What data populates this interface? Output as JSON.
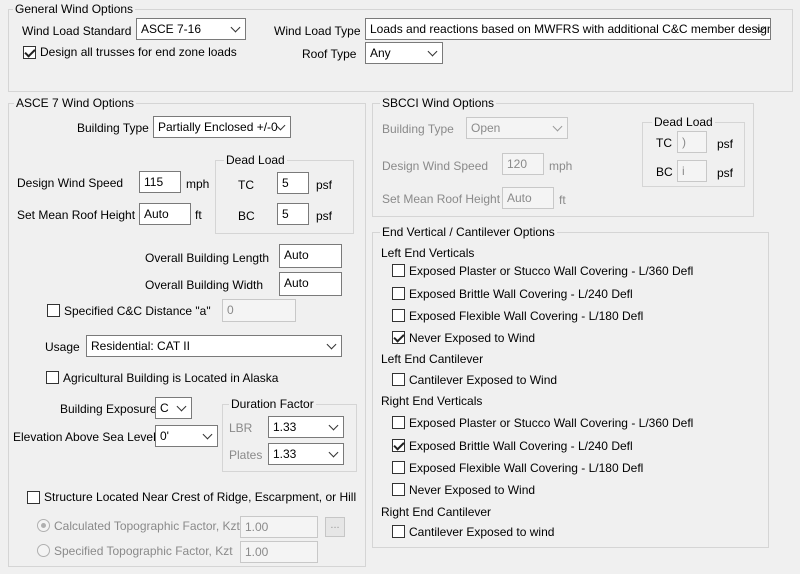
{
  "general": {
    "title": "General Wind Options",
    "wind_load_standard_label": "Wind Load Standard",
    "wind_load_standard_value": "ASCE 7-16",
    "wind_load_type_label": "Wind Load Type",
    "wind_load_type_value": "Loads and reactions based on MWFRS with additional C&C member design",
    "design_all_trusses_label": "Design all trusses for end zone loads",
    "roof_type_label": "Roof Type",
    "roof_type_value": "Any"
  },
  "asce": {
    "title": "ASCE 7 Wind Options",
    "building_type_label": "Building Type",
    "building_type_value": "Partially Enclosed +/-0",
    "design_wind_speed_label": "Design Wind Speed",
    "design_wind_speed_value": "115",
    "speed_unit": "mph",
    "mean_roof_height_label": "Set Mean Roof Height",
    "mean_roof_height_value": "Auto",
    "height_unit": "ft",
    "dead_load_title": "Dead Load",
    "tc_label": "TC",
    "tc_value": "5",
    "bc_label": "BC",
    "bc_value": "5",
    "psf": "psf",
    "overall_length_label": "Overall Building Length",
    "overall_length_value": "Auto",
    "overall_width_label": "Overall Building Width",
    "overall_width_value": "Auto",
    "specified_cc_label": "Specified C&C Distance \"a\"",
    "specified_cc_value": "0",
    "usage_label": "Usage",
    "usage_value": "Residential: CAT II",
    "agricultural_label": "Agricultural Building is Located in Alaska",
    "exposure_label": "Building Exposure",
    "exposure_value": "C",
    "elevation_label": "Elevation Above Sea Level",
    "elevation_value": "0'",
    "duration_title": "Duration Factor",
    "lbr_label": "LBR",
    "lbr_value": "1.33",
    "plates_label": "Plates",
    "plates_value": "1.33",
    "crest_label": "Structure Located Near Crest of Ridge, Escarpment, or Hill",
    "calc_topo_label": "Calculated Topographic Factor, Kzt",
    "calc_topo_value": "1.00",
    "ellipsis": "...",
    "spec_topo_label": "Specified Topographic Factor, Kzt",
    "spec_topo_value": "1.00"
  },
  "sbcci": {
    "title": "SBCCI Wind Options",
    "building_type_label": "Building Type",
    "building_type_value": "Open",
    "design_wind_speed_label": "Design Wind Speed",
    "design_wind_speed_value": "120",
    "speed_unit": "mph",
    "mean_roof_height_label": "Set Mean Roof Height",
    "mean_roof_height_value": "Auto",
    "height_unit": "ft",
    "dead_load_title": "Dead Load",
    "tc_label": "TC",
    "tc_value": ")",
    "bc_label": "BC",
    "bc_value": "i",
    "psf": "psf"
  },
  "end_vertical": {
    "title": "End Vertical / Cantilever Options",
    "left_verticals_title": "Left End Verticals",
    "left_verticals": [
      {
        "label": "Exposed Plaster or Stucco Wall Covering - L/360 Defl",
        "checked": false
      },
      {
        "label": "Exposed Brittle Wall Covering - L/240 Defl",
        "checked": false
      },
      {
        "label": "Exposed Flexible Wall Covering - L/180 Defl",
        "checked": false
      },
      {
        "label": "Never Exposed to Wind",
        "checked": true
      }
    ],
    "left_cantilever_title": "Left End Cantilever",
    "left_cantilever_label": "Cantilever Exposed to Wind",
    "right_verticals_title": "Right End Verticals",
    "right_verticals": [
      {
        "label": "Exposed Plaster or Stucco Wall Covering - L/360 Defl",
        "checked": false
      },
      {
        "label": "Exposed Brittle Wall Covering - L/240 Defl",
        "checked": true
      },
      {
        "label": "Exposed Flexible Wall Covering - L/180 Defl",
        "checked": false
      },
      {
        "label": "Never Exposed to Wind",
        "checked": false
      }
    ],
    "right_cantilever_title": "Right End Cantilever",
    "right_cantilever_label": "Cantilever Exposed to wind"
  }
}
